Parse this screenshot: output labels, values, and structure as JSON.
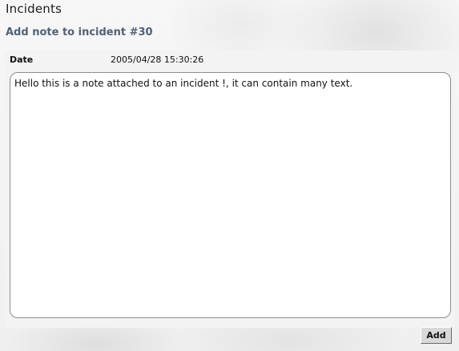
{
  "page": {
    "title": "Incidents"
  },
  "form": {
    "heading": "Add note to incident #30",
    "date_label": "Date",
    "date_value": "2005/04/28 15:30:26",
    "note_text": "Hello this is a note attached to an incident !, it can contain many text.",
    "add_label": "Add"
  }
}
